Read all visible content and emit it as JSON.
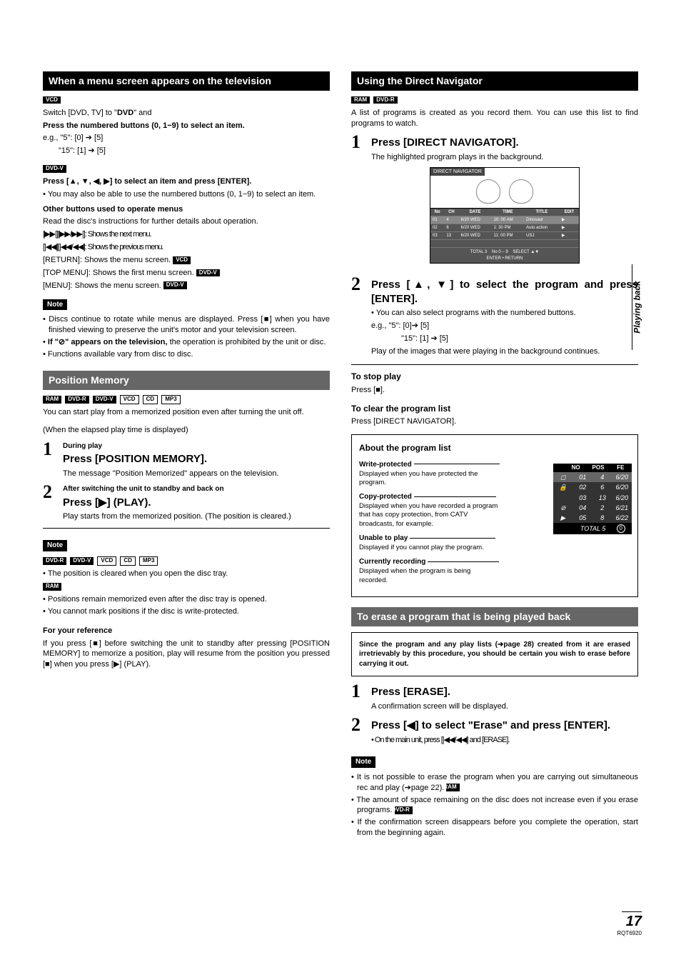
{
  "left": {
    "h1": "When a menu screen appears on the television",
    "vcd_tag": "VCD",
    "line1a": "Switch [DVD, TV] to \"",
    "line1b": "DVD",
    "line1c": "\" and",
    "line2": "Press the numbered buttons (0, 1−9) to select an item.",
    "eg1": "e.g., \"5\":   [0] ➔ [5]",
    "eg2": "\"15\": [1] ➔ [5]",
    "dvdv_tag": "DVD-V",
    "press_arrows": "Press [▲, ▼, ◀, ▶] to select an item and press [ENTER].",
    "bullet1": "You may also be able to use the numbered buttons (0, 1−9) to select an item.",
    "other_h": "Other buttons used to operate menus",
    "read": "Read the disc's instructions for further details about operation.",
    "op1": "[▶▶|][▶▶/▶▶|]:  Shows the next menu.",
    "op2": "[|◀◀][|◀◀/◀◀]:  Shows the previous menu.",
    "op3a": "[RETURN]:  Shows the menu screen.",
    "op4a": "[TOP MENU]:  Shows the first menu screen.",
    "op5a": "[MENU]:  Shows the menu screen.",
    "note": "Note",
    "n1": "Discs continue to rotate while menus are displayed. Press [■] when you have finished viewing to preserve the unit's motor and your television screen.",
    "n2a": "If \"",
    "n2b": "⊘",
    "n2c": "\" appears on the television,",
    "n2d": " the operation is prohibited by the unit or disc.",
    "n3": "Functions available vary from disc to disc.",
    "pm_h": "Position Memory",
    "tags": {
      "ram": "RAM",
      "dvdr": "DVD-R",
      "dvdv": "DVD-V",
      "vcd": "VCD",
      "cd": "CD",
      "mp3": "MP3"
    },
    "pm_p1": "You can start play from a memorized position even after turning the unit off.",
    "pm_p2": "(When the elapsed play time is displayed)",
    "step1_sub": "During play",
    "step1_t": "Press [POSITION MEMORY].",
    "step1_d": "The message \"Position Memorized\" appears on the television.",
    "step2_sub": "After switching the unit to standby and back on",
    "step2_t": "Press [▶] (PLAY).",
    "step2_d": "Play starts from the memorized position. (The position is cleared.)",
    "pn1": "The position is cleared when you open the disc tray.",
    "pn2": "Positions remain memorized even after the disc tray is opened.",
    "pn3": "You cannot mark positions if the disc is write-protected.",
    "ref_h": "For your reference",
    "ref_p": "If you press [■] before switching the unit to standby after pressing [POSITION MEMORY] to memorize a position, play will resume from the position you pressed [■] when you press [▶] (PLAY)."
  },
  "right": {
    "h1": "Using the Direct Navigator",
    "intro": "A list of programs is created as you record them. You can use this list to find programs to watch.",
    "s1_t": "Press [DIRECT NAVIGATOR].",
    "s1_d": "The highlighted program plays in the background.",
    "dn": {
      "title": "DIRECT NAVIGATOR",
      "hdr": {
        "no": "No",
        "ch": "CH",
        "date": "DATE",
        "time": "TIME",
        "title": "TITLE",
        "edit": "EDIT"
      },
      "rows": [
        {
          "no": "01",
          "ch": "4",
          "date": "6/20 WED",
          "time": "10: 00 AM",
          "title": "Dinosaur"
        },
        {
          "no": "02",
          "ch": "6",
          "date": "6/20 WED",
          "time": "1: 30 PM",
          "title": "Auto action"
        },
        {
          "no": "03",
          "ch": "13",
          "date": "6/20 WED",
          "time": "11: 00 PM",
          "title": "USJ"
        }
      ],
      "total": "TOTAL 3",
      "footer1": "No",
      "footer2": "0 – 9",
      "footer3": "SELECT ▲▼",
      "footer4": "ENTER",
      "footer5": "• RETURN"
    },
    "s2_t": "Press [▲, ▼] to select the program and press [ENTER].",
    "s2_b1": "You can also select programs with the numbered buttons.",
    "s2_eg1": "e.g.,        \"5\":   [0]➔ [5]",
    "s2_eg2": "\"15\": [1] ➔ [5]",
    "s2_d": "Play of the images that were playing in the background continues.",
    "stop_h": "To stop play",
    "stop_p": "Press [■].",
    "clear_h": "To clear the program list",
    "clear_p": "Press [DIRECT NAVIGATOR].",
    "about": {
      "title": "About the program list",
      "wp_h": "Write-protected",
      "wp_d": "Displayed when you have protected the program.",
      "cp_h": "Copy-protected",
      "cp_d": "Displayed when you have recorded a program that has copy protection, from CATV broadcasts, for example.",
      "up_h": "Unable to play",
      "up_d": "Displayed if you cannot play the program.",
      "cr_h": "Currently recording",
      "cr_d": "Displayed when the program is being recorded.",
      "hdr": {
        "no": "NO",
        "pos": "POS",
        "fe": "FE"
      },
      "rows": [
        {
          "no": "01",
          "pos": "4",
          "fe": "6/20"
        },
        {
          "no": "02",
          "pos": "6",
          "fe": "6/20"
        },
        {
          "no": "03",
          "pos": "13",
          "fe": "6/20"
        },
        {
          "no": "04",
          "pos": "2",
          "fe": "6/21"
        },
        {
          "no": "05",
          "pos": "8",
          "fe": "6/22"
        }
      ],
      "total": "TOTAL 5",
      "zero": "0"
    },
    "erase_h": "To erase a program that is being played back",
    "warn": "Since the program and any play lists (➔page 28) created from it are erased irretrievably by this procedure, you should be certain you wish to erase before carrying it out.",
    "e1_t": "Press [ERASE].",
    "e1_d": "A confirmation screen will be displayed.",
    "e2_t": "Press [◀] to select \"Erase\" and press [ENTER].",
    "e2_b": "On the main unit, press [|◀◀/◀◀] and [ERASE].",
    "en1": "It is not possible to erase the program when you are carrying out simultaneous rec and play (➔page 22).",
    "en2": "The amount of space remaining on the disc does not increase even if you erase programs.",
    "en3": "If the confirmation screen disappears before you complete the operation, start from the beginning again."
  },
  "side": "Playing back",
  "page": {
    "num": "17",
    "code": "RQT6920"
  }
}
